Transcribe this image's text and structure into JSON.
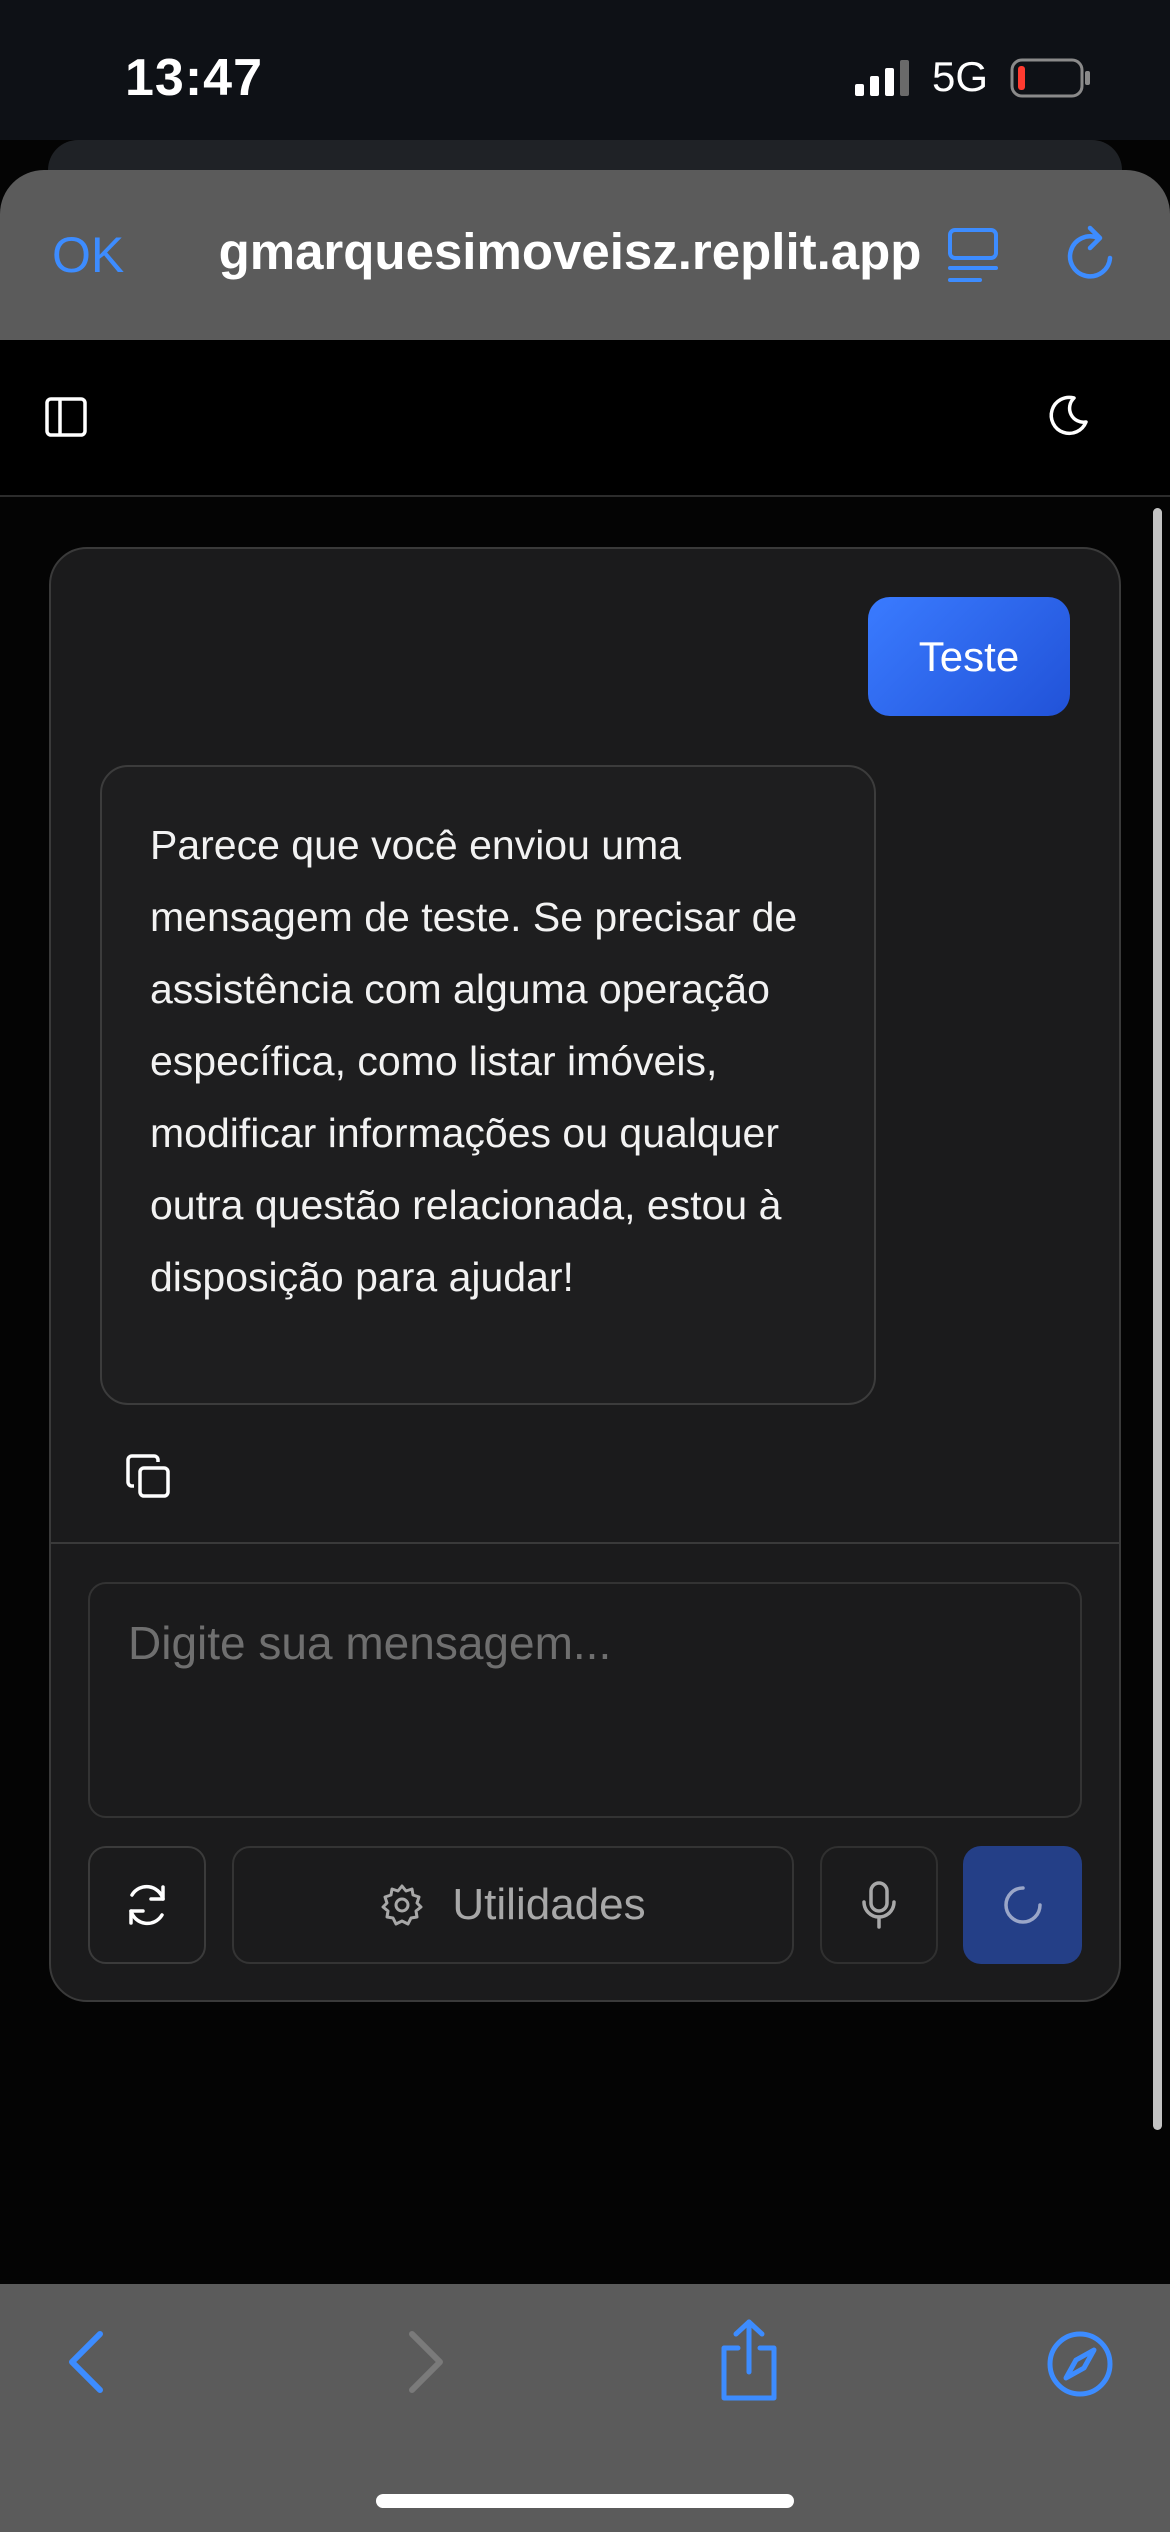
{
  "status_bar": {
    "time": "13:47",
    "network": "5G"
  },
  "browser": {
    "done_label": "OK",
    "url": "gmarquesimoveisz.replit.app"
  },
  "chat": {
    "messages": [
      {
        "role": "user",
        "text": "Teste"
      },
      {
        "role": "assistant",
        "text": "Parece que você enviou uma mensagem de teste. Se precisar de assistência com alguma operação específica, como listar imóveis, modificar informações ou qualquer outra questão relacionada, estou à disposição para ajudar!"
      }
    ],
    "input_placeholder": "Digite sua mensagem...",
    "utilities_label": "Utilidades"
  },
  "colors": {
    "accent": "#3d8cff",
    "user_bubble": "#2f6bf2",
    "send_button": "#243f87",
    "battery_low": "#ff3b30"
  }
}
